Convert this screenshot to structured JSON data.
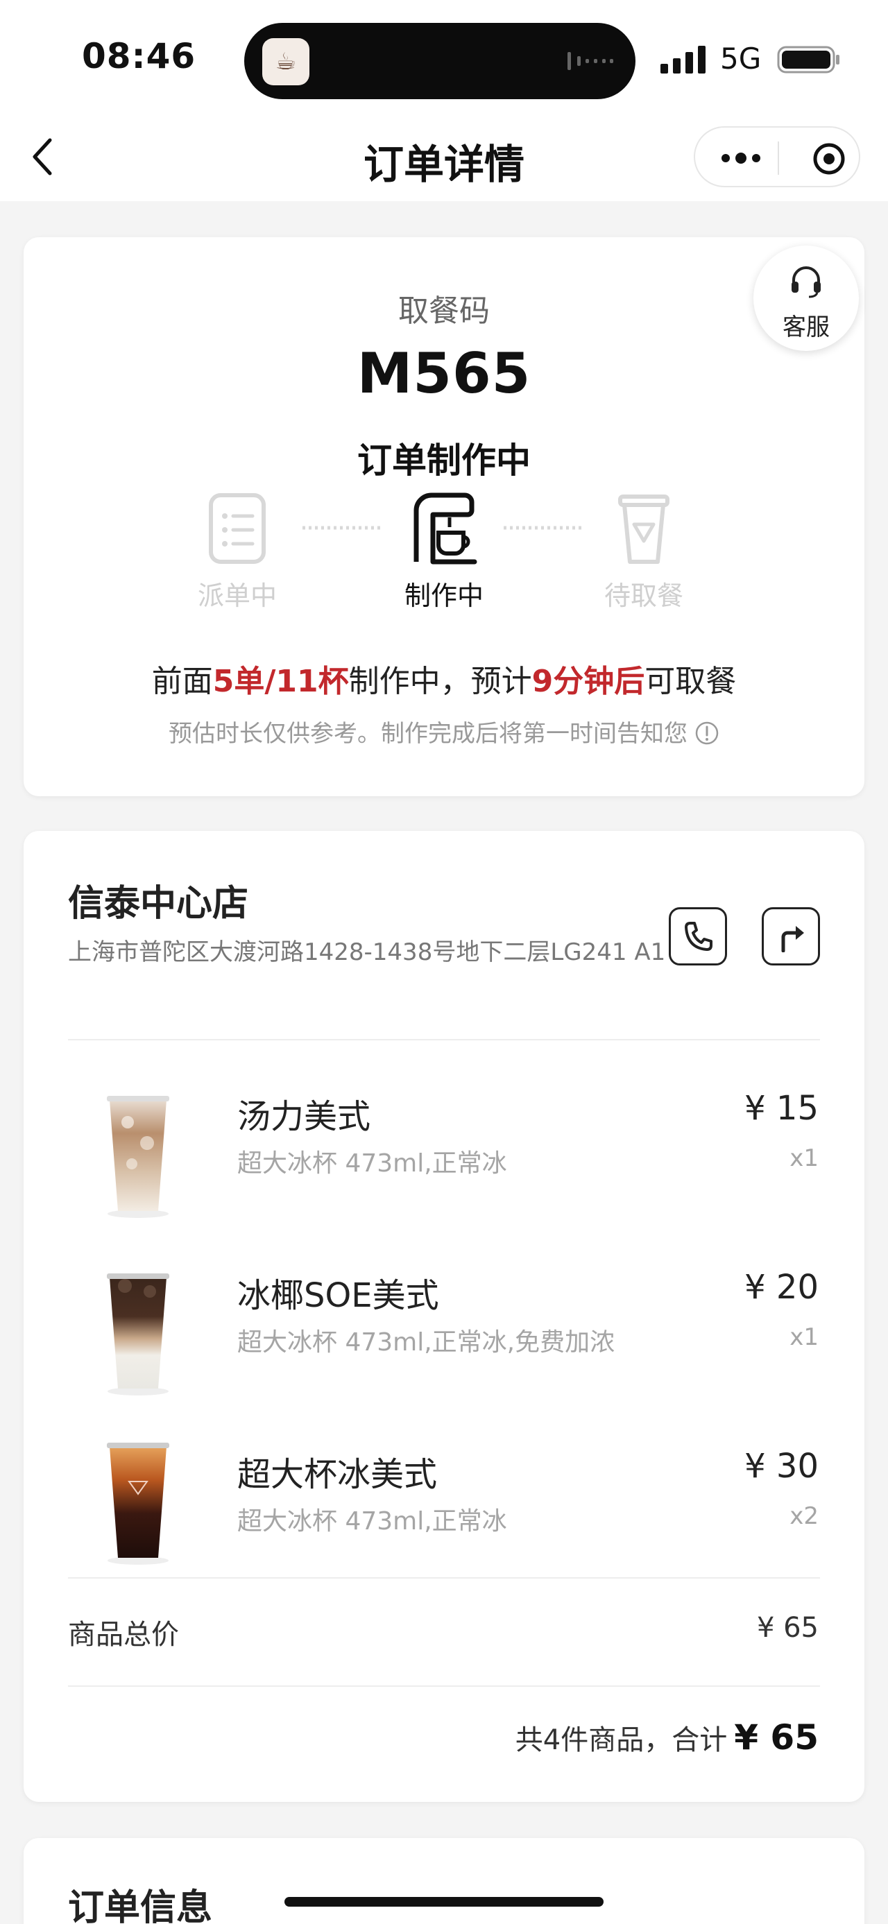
{
  "status_bar": {
    "time": "08:46",
    "network": "5G"
  },
  "nav": {
    "title": "订单详情"
  },
  "order_status": {
    "pickup_label": "取餐码",
    "pickup_code": "M565",
    "status_title": "订单制作中",
    "customer_service_label": "客服",
    "steps": [
      {
        "label": "派单中",
        "state": "done"
      },
      {
        "label": "制作中",
        "state": "active"
      },
      {
        "label": "待取餐",
        "state": "pending"
      }
    ],
    "queue": {
      "prefix": "前面",
      "orders_cups": "5单/11杯",
      "middle": "制作中，预计",
      "eta": "9分钟后",
      "suffix": "可取餐"
    },
    "note": "预估时长仅供参考。制作完成后将第一时间告知您"
  },
  "store": {
    "name": "信泰中心店",
    "address": "上海市普陀区大渡河路1428-1438号地下二层LG241 A1"
  },
  "items": [
    {
      "name": "汤力美式",
      "spec": "超大冰杯 473ml,正常冰",
      "price": "¥ 15",
      "qty": "x1",
      "image": "tonic-americano"
    },
    {
      "name": "冰椰SOE美式",
      "spec": "超大冰杯 473ml,正常冰,免费加浓",
      "price": "¥ 20",
      "qty": "x1",
      "image": "coconut-soe-americano"
    },
    {
      "name": "超大杯冰美式",
      "spec": "超大冰杯 473ml,正常冰",
      "price": "¥ 30",
      "qty": "x2",
      "image": "iced-americano"
    }
  ],
  "summary": {
    "subtotal_label": "商品总价",
    "subtotal_value": "¥ 65",
    "total_text": "共4件商品，合计",
    "total_amount": "¥ 65"
  },
  "order_info": {
    "title": "订单信息"
  },
  "colors": {
    "accent_red": "#c2282c",
    "muted": "#a5a5a5",
    "background": "#f4f4f4"
  }
}
